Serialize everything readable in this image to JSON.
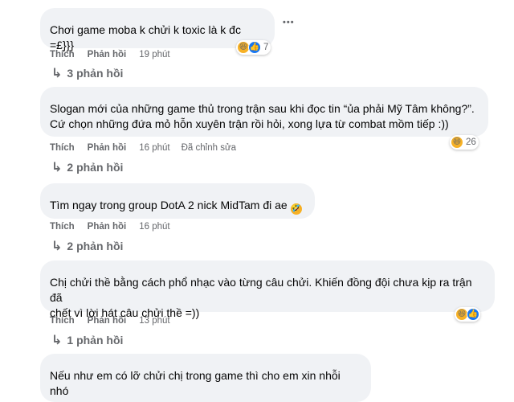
{
  "colors": {
    "bubble_bg": "#f0f2f5",
    "meta_text": "#65676b",
    "haha_reaction": "#f7b125",
    "like_reaction": "#1877f2"
  },
  "labels": {
    "like": "Thích",
    "reply": "Phản hồi",
    "more": "•••"
  },
  "comments": [
    {
      "text": "Chơi game moba k chửi k toxic là k đc =£}}}",
      "time": "19 phút",
      "edited": "",
      "reaction_count": "7",
      "reactions": [
        "haha-icon",
        "like-icon"
      ],
      "replies": "3 phản hồi"
    },
    {
      "text": "Slogan mới của những game thủ trong trận sau khi đọc tin “ủa phải Mỹ Tâm không?”.\nCứ chọn những đứa mỏ hỗn xuyên trận rồi hỏi, xong lựa từ combat mồm tiếp :))",
      "time": "16 phút",
      "edited": "Đã chỉnh sửa",
      "reaction_count": "26",
      "reactions": [
        "haha-icon"
      ],
      "replies": "2 phản hồi"
    },
    {
      "text": "Tìm ngay trong group DotA 2 nick MidTam đi ae",
      "time": "16 phút",
      "edited": "",
      "reaction_count": "",
      "reactions": [],
      "replies": "2 phản hồi"
    },
    {
      "text": "Chị chửi thề bằng cách phổ nhạc vào từng câu chửi. Khiến đồng đội chưa kịp ra trận đã\nchết vì lời hát câu chửi thề =))",
      "time": "13 phút",
      "edited": "",
      "reaction_count": "",
      "reactions": [
        "haha-icon",
        "like-icon"
      ],
      "replies": "1 phản hồi"
    },
    {
      "text": "Nếu như em có lỡ chửi chị trong game thì cho em xin nhỗi nhó",
      "time": "",
      "edited": "",
      "reaction_count": "",
      "reactions": [],
      "replies": ""
    }
  ]
}
